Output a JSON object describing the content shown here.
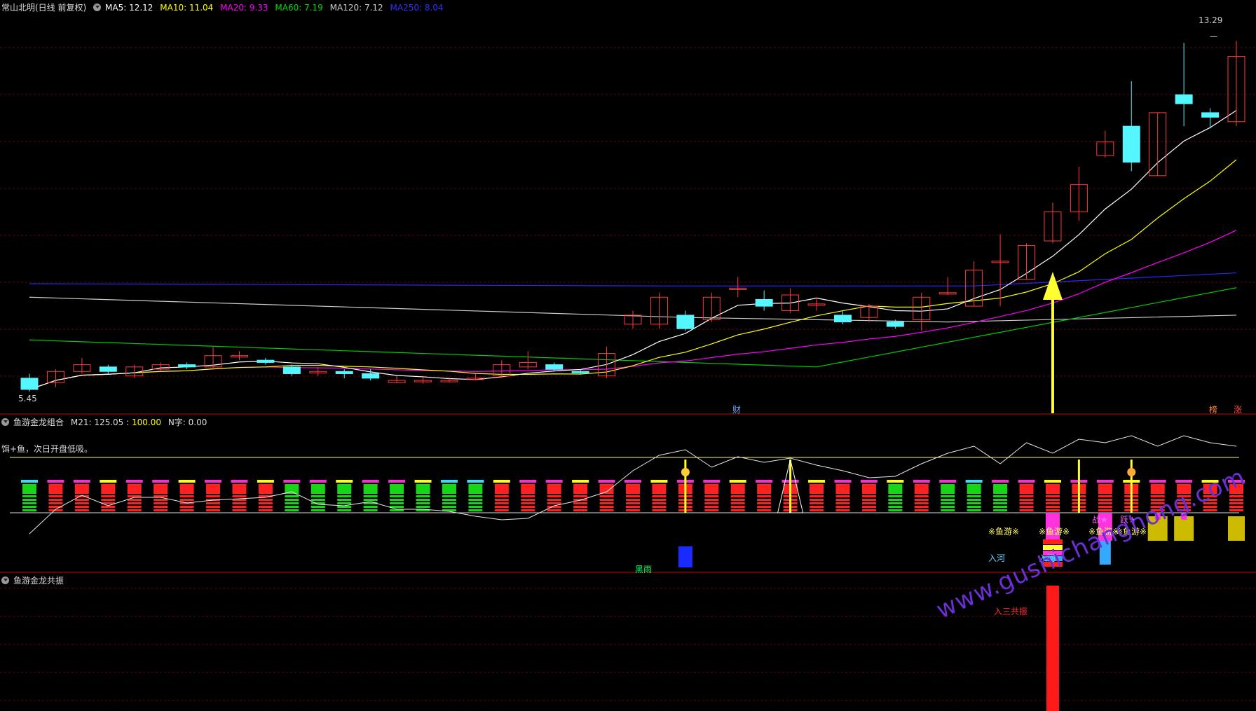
{
  "colors": {
    "up": "#ff3b3b",
    "down": "#54f6ff",
    "ma5": "#ffffff",
    "ma10": "#ffff00",
    "ma20": "#ff00ff",
    "ma60": "#00cc00",
    "ma120": "#cccccc",
    "ma250": "#2828ff",
    "grid": "#5a0a0a",
    "sep": "#b01010",
    "arrow": "#ffff33",
    "watermark": "#6b2fd6"
  },
  "main": {
    "header": {
      "title": "常山北明(日线 前复权)",
      "ma5_label": "MA5: 12.12",
      "ma10_label": "MA10: 11.04",
      "ma20_label": "MA20: 9.33",
      "ma60_label": "MA60: 7.19",
      "ma120_label": "MA120: 7.12",
      "ma250_label": "MA250: 8.04"
    },
    "high_label": "13.29",
    "low_label": "5.45",
    "markers": [
      {
        "text": "财",
        "color": "#66aaff"
      },
      {
        "text": "榜",
        "color": "#ff8844"
      },
      {
        "text": "涨",
        "color": "#ff4444"
      }
    ]
  },
  "ind1": {
    "header": {
      "title": "鱼游金龙组合",
      "m21_label": "M21: 125.05",
      "m21_ref": ": 100.00",
      "n_label": "N字: 0.00"
    },
    "hint": "饵+鱼，次日开盘低吸。",
    "labels": [
      "※鱼游※",
      "※鱼游※",
      "※鱼游※",
      "※鱼游※",
      "入河",
      "入河",
      "黑雨",
      "战★",
      "跃★"
    ],
    "money_icons": [
      "money-bag-icon"
    ]
  },
  "ind2": {
    "header": {
      "title": "鱼游金龙共振"
    },
    "resonance_label": "入三共振"
  },
  "watermark": "www.gushichanghong.com",
  "chart_data": {
    "type": "candlestick",
    "title": "常山北明(日线 前复权)",
    "y_range": [
      5.2,
      13.7
    ],
    "candles": [
      [
        5.7,
        5.45,
        5.8,
        5.4
      ],
      [
        5.6,
        5.85,
        5.9,
        5.5
      ],
      [
        5.85,
        6.0,
        6.15,
        5.8
      ],
      [
        5.95,
        5.85,
        6.0,
        5.8
      ],
      [
        5.75,
        5.95,
        6.0,
        5.7
      ],
      [
        5.9,
        6.0,
        6.05,
        5.85
      ],
      [
        6.0,
        5.95,
        6.05,
        5.9
      ],
      [
        5.95,
        6.2,
        6.4,
        5.9
      ],
      [
        6.2,
        6.2,
        6.3,
        6.1
      ],
      [
        6.1,
        6.05,
        6.15,
        6.0
      ],
      [
        5.95,
        5.8,
        6.0,
        5.75
      ],
      [
        5.85,
        5.85,
        5.95,
        5.75
      ],
      [
        5.85,
        5.8,
        5.9,
        5.7
      ],
      [
        5.8,
        5.7,
        5.9,
        5.65
      ],
      [
        5.6,
        5.65,
        5.75,
        5.6
      ],
      [
        5.62,
        5.65,
        5.72,
        5.58
      ],
      [
        5.62,
        5.65,
        5.72,
        5.6
      ],
      [
        5.7,
        5.7,
        5.8,
        5.65
      ],
      [
        5.75,
        6.0,
        6.1,
        5.7
      ],
      [
        5.95,
        6.05,
        6.3,
        5.9
      ],
      [
        6.0,
        5.9,
        6.05,
        5.85
      ],
      [
        5.85,
        5.82,
        5.9,
        5.78
      ],
      [
        5.75,
        6.25,
        6.4,
        5.7
      ],
      [
        6.9,
        7.1,
        7.2,
        6.8
      ],
      [
        6.9,
        7.5,
        7.6,
        6.8
      ],
      [
        7.1,
        6.8,
        7.2,
        6.75
      ],
      [
        7.0,
        7.5,
        7.6,
        6.95
      ],
      [
        7.7,
        7.7,
        7.95,
        7.5
      ],
      [
        7.45,
        7.3,
        7.65,
        7.2
      ],
      [
        7.2,
        7.55,
        7.7,
        7.15
      ],
      [
        7.35,
        7.35,
        7.5,
        7.2
      ],
      [
        7.1,
        6.95,
        7.2,
        6.9
      ],
      [
        7.05,
        7.3,
        7.35,
        6.95
      ],
      [
        6.95,
        6.85,
        7.0,
        6.8
      ],
      [
        7.0,
        7.5,
        7.6,
        6.75
      ],
      [
        7.6,
        7.6,
        7.95,
        7.55
      ],
      [
        7.3,
        8.1,
        8.3,
        7.3
      ],
      [
        8.3,
        8.3,
        8.9,
        7.3
      ],
      [
        7.9,
        8.65,
        8.7,
        7.9
      ],
      [
        8.75,
        9.4,
        9.6,
        8.7
      ],
      [
        9.4,
        10.0,
        10.4,
        9.2
      ],
      [
        10.65,
        10.95,
        11.2,
        10.6
      ],
      [
        11.3,
        10.5,
        12.3,
        10.3
      ],
      [
        10.2,
        11.6,
        11.6,
        10.2
      ],
      [
        12.0,
        11.8,
        13.15,
        11.3
      ],
      [
        11.6,
        11.5,
        11.7,
        11.25
      ],
      [
        11.4,
        12.85,
        13.2,
        11.3
      ]
    ],
    "ma120": [
      [
        0,
        7.5
      ],
      [
        25,
        7.05
      ],
      [
        35,
        6.95
      ],
      [
        46,
        7.1
      ]
    ],
    "ma250": [
      [
        0,
        7.8
      ],
      [
        24,
        7.75
      ],
      [
        36,
        7.75
      ],
      [
        46,
        8.04
      ]
    ]
  }
}
